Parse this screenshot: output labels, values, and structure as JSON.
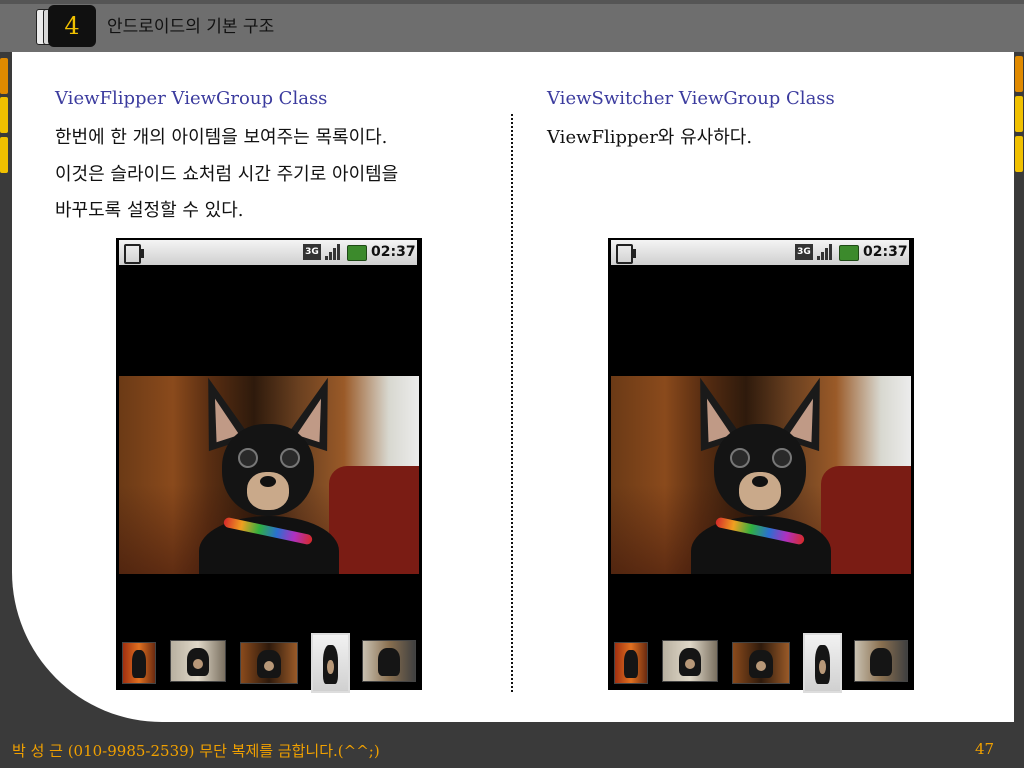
{
  "header": {
    "section_number": "4",
    "title": "안드로이드의 기본 구조"
  },
  "left": {
    "heading": "ViewFlipper ViewGroup Class",
    "lines": [
      "한번에 한 개의 아이템을 보여주는 목록이다.",
      "이것은 슬라이드 쇼처럼 시간 주기로 아이템을",
      "바꾸도록 설정할 수 있다."
    ]
  },
  "right": {
    "heading": "ViewSwitcher ViewGroup Class",
    "lines": [
      "ViewFlipper와 유사하다."
    ]
  },
  "phones": {
    "left": {
      "status_time": "02:37",
      "network": "3G"
    },
    "right": {
      "status_time": "02:37",
      "network": "3G"
    }
  },
  "footer": {
    "copyright": "박 성 근 (010-9985-2539)  무단 복제를 금합니다.(^^;)",
    "page_number": "47"
  },
  "colors": {
    "heading": "#3b3b9e",
    "footer_text": "#f0a000",
    "badge_text": "#f0c000",
    "accent_orange": "#e08a00",
    "accent_yellow": "#f0c000"
  }
}
